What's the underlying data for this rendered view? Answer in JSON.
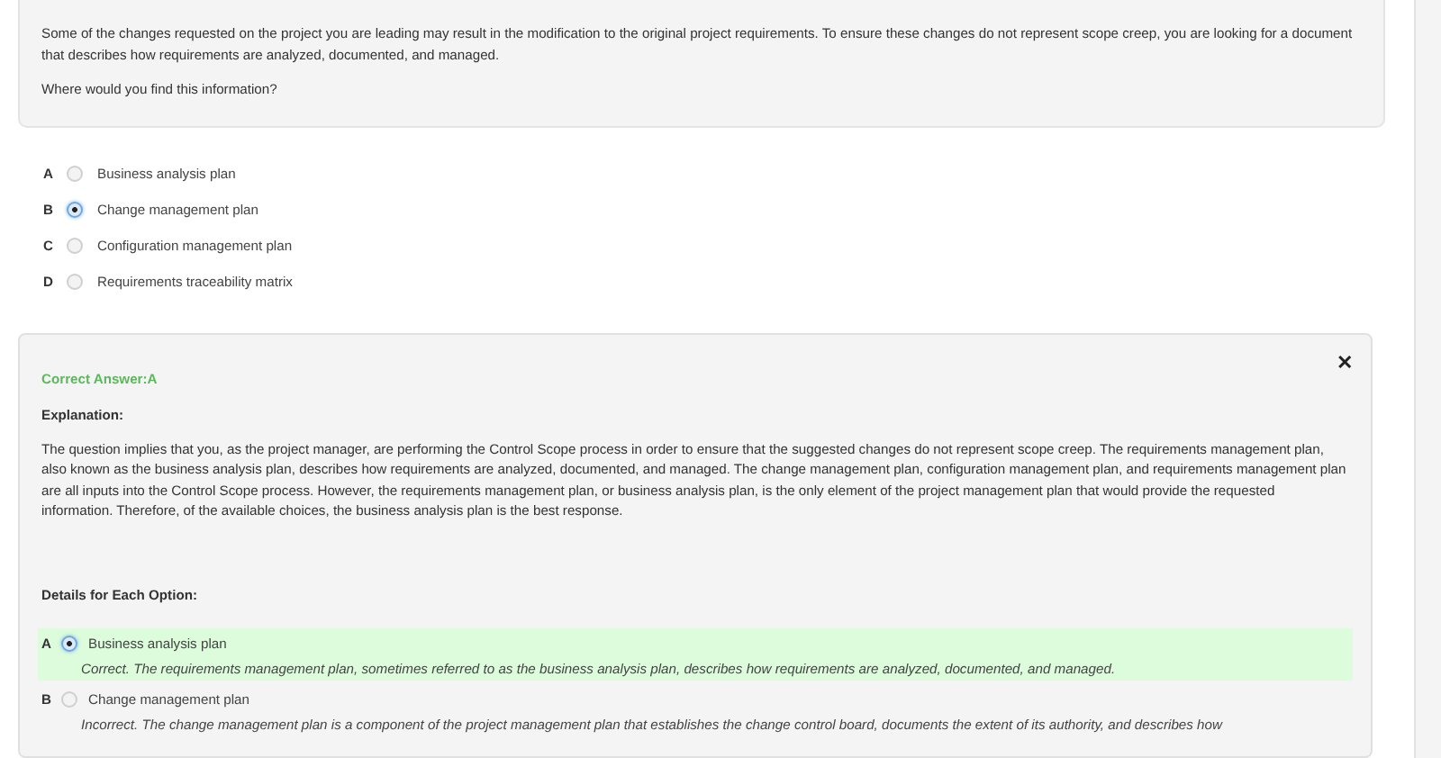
{
  "question": {
    "text": "Some of the changes requested on the project you are leading may result in the modification to the original project requirements. To ensure these changes do not represent scope creep, you are looking for a document that describes how requirements are analyzed, documented, and managed.",
    "prompt": "Where would you find this information?"
  },
  "options": [
    {
      "letter": "A",
      "label": "Business analysis plan",
      "selected": false
    },
    {
      "letter": "B",
      "label": "Change management plan",
      "selected": true
    },
    {
      "letter": "C",
      "label": "Configuration management plan",
      "selected": false
    },
    {
      "letter": "D",
      "label": "Requirements traceability matrix",
      "selected": false
    }
  ],
  "answer": {
    "correct": "Correct Answer:A",
    "close": "✕",
    "explanation_heading": "Explanation:",
    "explanation": "The question implies that you, as the project manager, are performing the Control Scope process in order to ensure that the suggested changes do not represent scope creep. The requirements management plan, also known as the business analysis plan, describes how requirements are analyzed, documented, and managed. The change management plan, configuration management plan, and requirements management plan are all inputs into the Control Scope process. However, the requirements management plan, or business analysis plan, is the only element of the project management plan that would provide the requested information. Therefore, of the available choices, the business analysis plan is the best response.",
    "details_heading": "Details for Each Option:",
    "details": [
      {
        "letter": "A",
        "label": "Business analysis plan",
        "correct": true,
        "note": "Correct. The requirements management plan, sometimes referred to as the business analysis plan, describes how requirements are analyzed, documented, and managed."
      },
      {
        "letter": "B",
        "label": "Change management plan",
        "correct": false,
        "note": "Incorrect. The change management plan is a component of the project management plan that establishes the change control board, documents the extent of its authority, and describes how"
      }
    ]
  }
}
